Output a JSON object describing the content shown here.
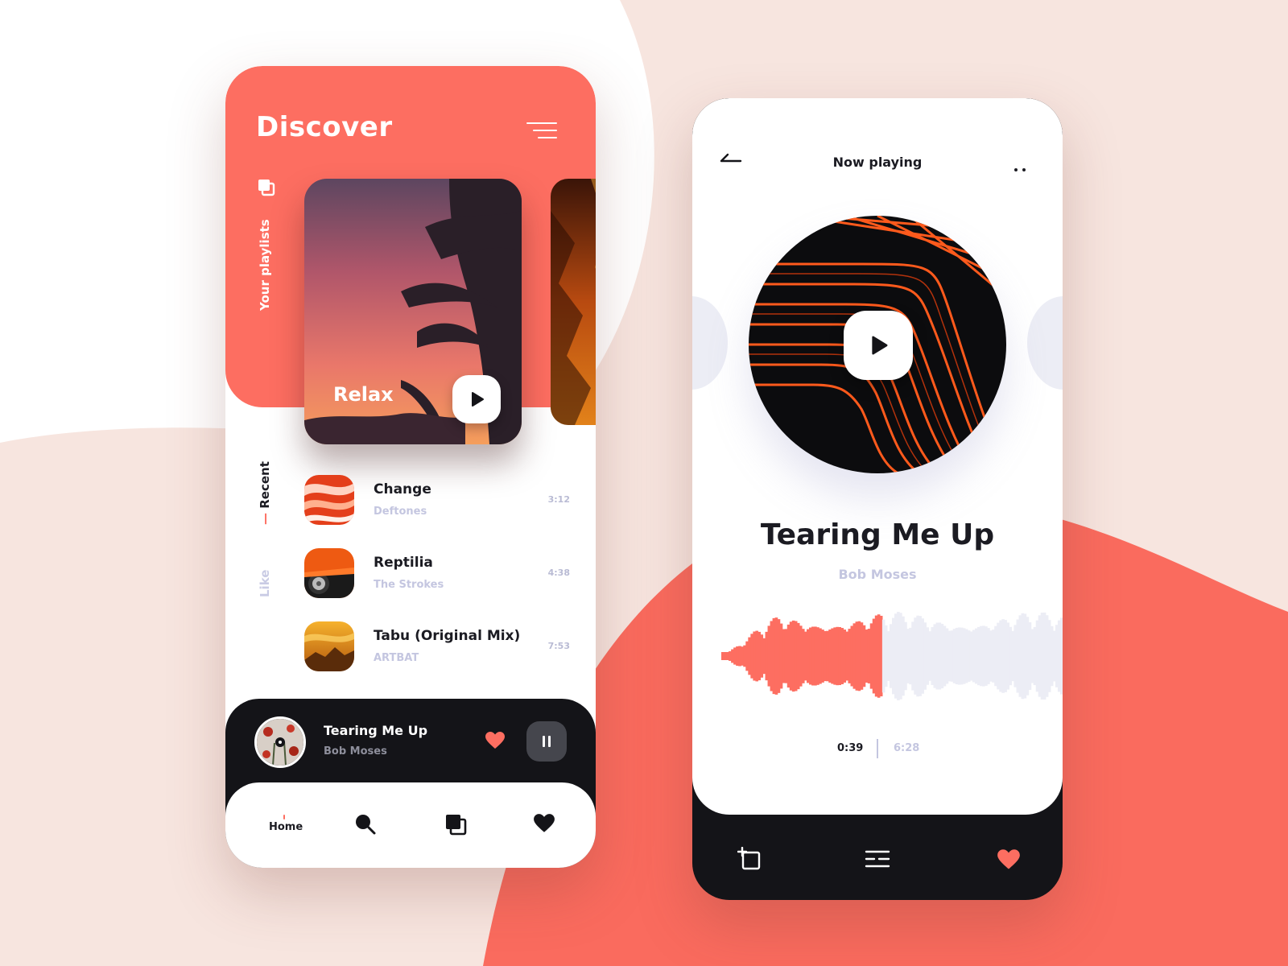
{
  "colors": {
    "accent": "#fd6e61",
    "dark": "#141418",
    "muted": "#c4c6e0",
    "background": "#f7e5df"
  },
  "discover": {
    "title": "Discover",
    "menu_icon": "menu-icon",
    "playlists_label": "Your playlists",
    "playlists_icon": "library-icon",
    "featured": {
      "label": "Relax",
      "play_icon": "play-icon"
    },
    "tabs": {
      "recent": "Recent",
      "recent_dash": "—",
      "like": "Like"
    },
    "tracks": [
      {
        "title": "Change",
        "artist": "Deftones",
        "duration": "3:12"
      },
      {
        "title": "Reptilia",
        "artist": "The Strokes",
        "duration": "4:38"
      },
      {
        "title": "Tabu (Original Mix)",
        "artist": "ARTBAT",
        "duration": "7:53"
      }
    ]
  },
  "mini_player": {
    "title": "Tearing Me Up",
    "artist": "Bob Moses",
    "heart_icon": "heart-icon",
    "pause_icon": "pause-icon"
  },
  "nav": {
    "home_label": "Home",
    "search_icon": "search-icon",
    "library_icon": "library-icon",
    "favorites_icon": "heart-icon"
  },
  "now_playing": {
    "header": "Now playing",
    "back_icon": "back-arrow-icon",
    "more_icon": "more-icon",
    "song": "Tearing Me Up",
    "artist": "Bob Moses",
    "progress": 0.47,
    "time_current": "0:39",
    "time_total": "6:28",
    "controls": {
      "add_icon": "add-to-playlist-icon",
      "queue_icon": "queue-icon",
      "favorite_icon": "heart-icon"
    }
  }
}
